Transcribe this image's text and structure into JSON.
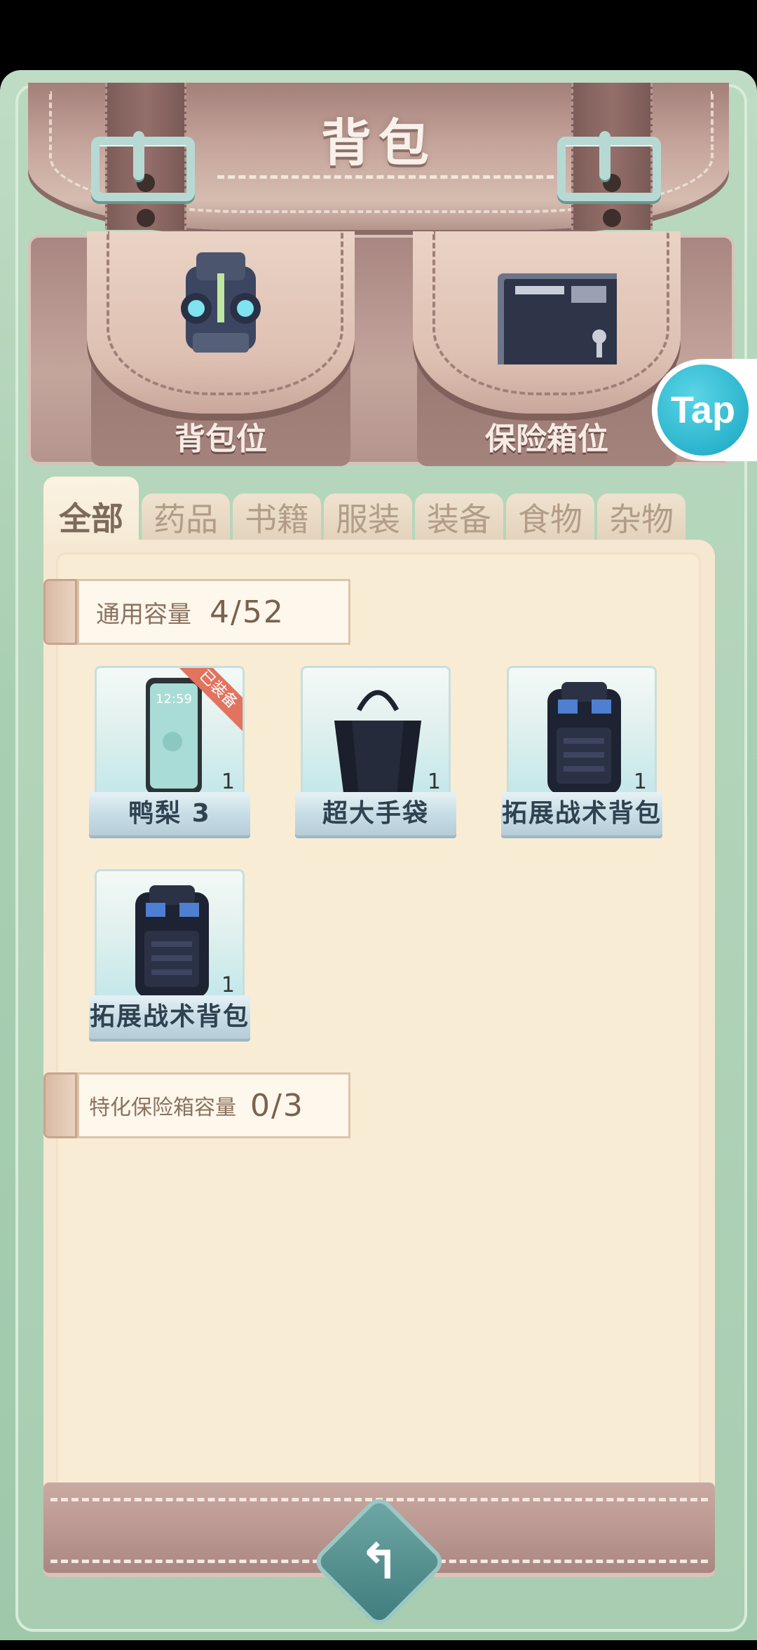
{
  "header": {
    "title": "背包"
  },
  "pockets": [
    {
      "label": "背包位",
      "icon": "armor-vest-icon"
    },
    {
      "label": "保险箱位",
      "icon": "safe-box-icon"
    }
  ],
  "tap_badge": {
    "label": "Tap"
  },
  "tabs": [
    {
      "label": "全部",
      "active": true
    },
    {
      "label": "药品"
    },
    {
      "label": "书籍"
    },
    {
      "label": "服装"
    },
    {
      "label": "装备"
    },
    {
      "label": "食物"
    },
    {
      "label": "杂物"
    }
  ],
  "general_capacity": {
    "label": "通用容量",
    "value": "4/52"
  },
  "items": [
    {
      "name": "鸭梨 3",
      "count": "1",
      "icon": "phone-icon",
      "badge": "已装备"
    },
    {
      "name": "超大手袋",
      "count": "1",
      "icon": "handbag-icon"
    },
    {
      "name": "拓展战术背包",
      "count": "1",
      "icon": "tactical-backpack-icon"
    },
    {
      "name": "拓展战术背包",
      "count": "1",
      "icon": "tactical-backpack-icon"
    }
  ],
  "safe_capacity": {
    "label": "特化保险箱容量",
    "value": "0/3"
  },
  "footer": {
    "back_icon": "back-arrow-icon",
    "back_glyph": "↰"
  },
  "colors": {
    "panel": "#f9ecd5",
    "accent_teal": "#2bb4cd",
    "equipped_badge": "#e2735e",
    "leather": "#a47f7a"
  }
}
